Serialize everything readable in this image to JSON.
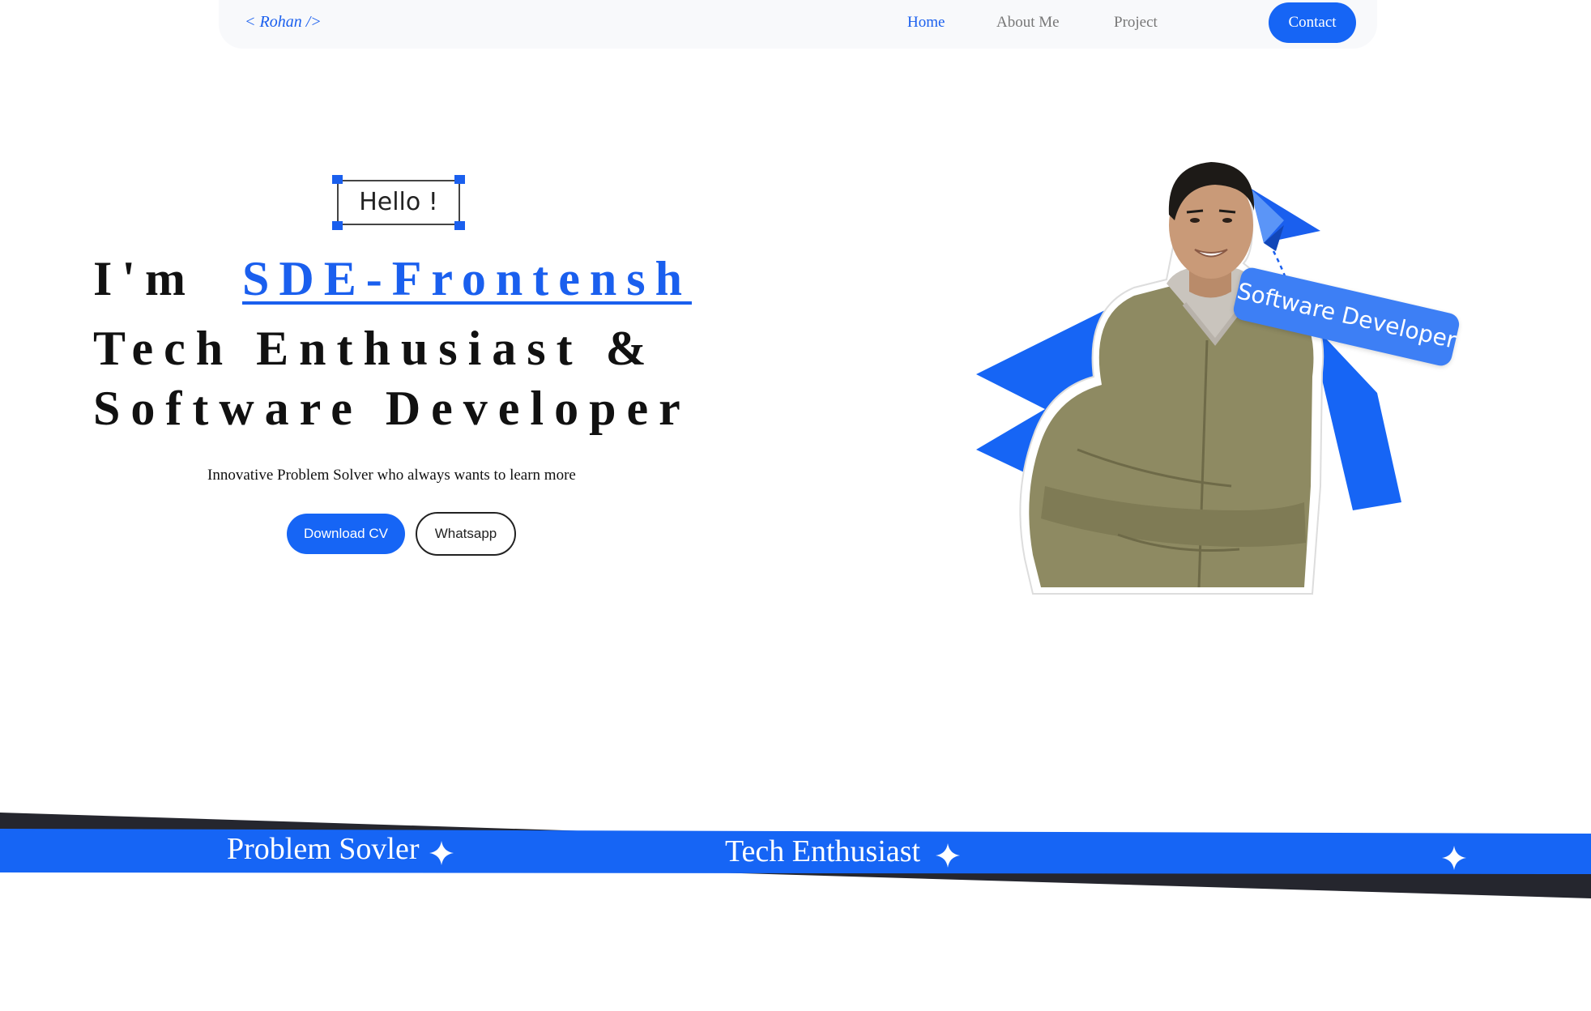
{
  "nav": {
    "logo": "< Rohan />",
    "links": [
      "Home",
      "About Me",
      "Project"
    ],
    "active": "Home",
    "contact_label": "Contact"
  },
  "hero": {
    "hello": "Hello !",
    "intro_label": "I'm",
    "role": "SDE-Frontensh",
    "heading_line2": "Tech Enthusiast &",
    "heading_line3": "Software Developer",
    "tagline": "Innovative Problem Solver who always wants to learn more",
    "download_label": "Download CV",
    "whatsapp_label": "Whatsapp",
    "badge": "Software Developer"
  },
  "banner": {
    "items": [
      "Problem Sovler",
      "Tech Enthusiast"
    ]
  },
  "colors": {
    "accent": "#1665f5",
    "dark_stripe": "#25262e",
    "jacket": "#8e8a62"
  },
  "icons": [
    "sparkle-star-icon",
    "paper-plane-icon"
  ]
}
